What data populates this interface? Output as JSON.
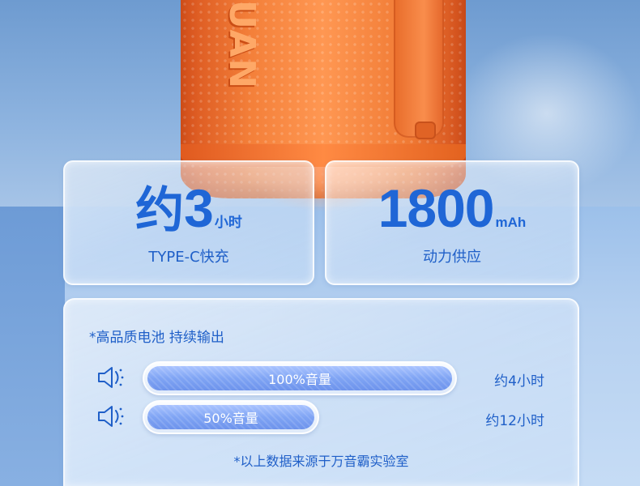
{
  "speaker": {
    "logo_text": "UAN"
  },
  "stats": [
    {
      "prefix": "约",
      "number": "3",
      "unit": "小时",
      "subtitle": "TYPE-C快充"
    },
    {
      "prefix": "",
      "number": "1800",
      "unit": "mAh",
      "subtitle": "动力供应"
    }
  ],
  "battery": {
    "title": "*高品质电池 持续输出",
    "rows": [
      {
        "icon": "speaker-volume-icon",
        "label": "100%音量",
        "level": 1.0,
        "time": "约4小时"
      },
      {
        "icon": "speaker-volume-icon",
        "label": "50%音量",
        "level": 0.5,
        "time": "约12小时"
      }
    ],
    "footnote": "*以上数据来源于万音霸实验室"
  },
  "colors": {
    "accent_blue": "#1f66d6",
    "speaker_orange": "#f4803a",
    "bar_fill": "#7fa4f4"
  }
}
